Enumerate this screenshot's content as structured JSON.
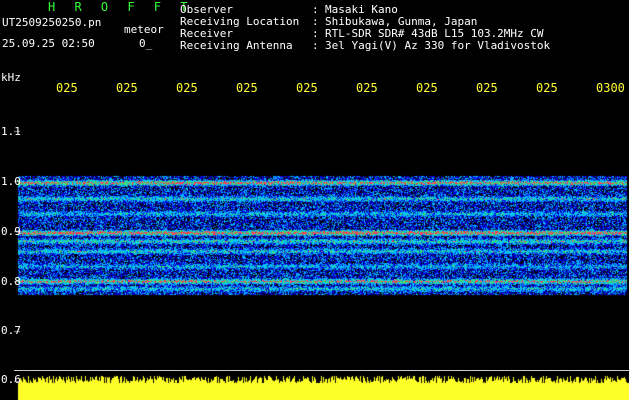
{
  "header": {
    "brand": "H R O F F T",
    "filename": "UT2509250250.pn",
    "suffix": "meteor",
    "datetime": "25.09.25 02:50",
    "datetime_value": "0_",
    "fields": [
      {
        "label": "Observer",
        "colon": ":",
        "value": "Masaki Kano"
      },
      {
        "label": "Receiving Location",
        "colon": ":",
        "value": "Shibukawa, Gunma, Japan"
      },
      {
        "label": "Receiver",
        "colon": ":",
        "value": "RTL-SDR SDR# 43dB L15 103.2MHz CW"
      },
      {
        "label": "Receiving Antenna",
        "colon": ":",
        "value": "3el Yagi(V) Az 330 for Vladivostok"
      }
    ]
  },
  "colors": {
    "background": "#000000",
    "text": "#ffffff",
    "accent": "#ffff33",
    "brand": "#33ff33"
  },
  "chart_data": {
    "type": "heatmap",
    "ylabel": "kHz",
    "x_ticks": [
      "025",
      "025",
      "025",
      "025",
      "025",
      "025",
      "025",
      "025",
      "025",
      "0300"
    ],
    "y_ticks": [
      "1.1",
      "1.0",
      "0.9",
      "0.8",
      "0.7",
      "0.6"
    ],
    "ylim": [
      0.6,
      1.15
    ],
    "bands": [
      {
        "freq": 0.997,
        "intensity": 0.9
      },
      {
        "freq": 0.965,
        "intensity": 0.5
      },
      {
        "freq": 0.935,
        "intensity": 0.4
      },
      {
        "freq": 0.897,
        "intensity": 1.0
      },
      {
        "freq": 0.88,
        "intensity": 0.55
      },
      {
        "freq": 0.86,
        "intensity": 0.45
      },
      {
        "freq": 0.83,
        "intensity": 0.35
      },
      {
        "freq": 0.8,
        "intensity": 0.8
      },
      {
        "freq": 0.785,
        "intensity": 0.4
      }
    ],
    "noise_range_khz": [
      0.775,
      1.01
    ]
  }
}
